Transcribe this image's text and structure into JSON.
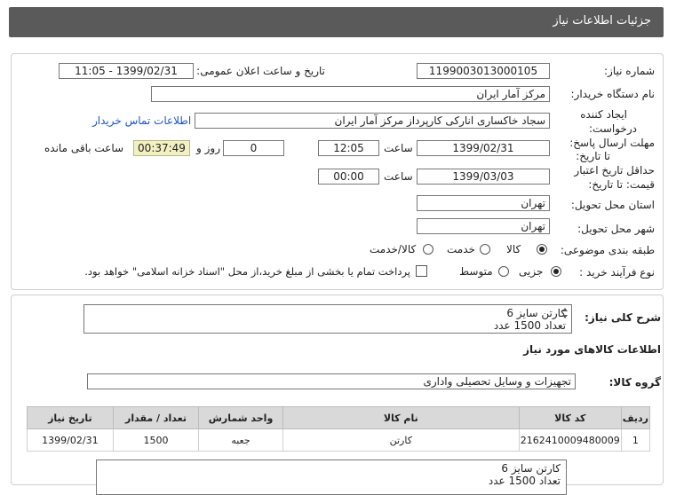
{
  "header": {
    "title": "جزئیات اطلاعات نیاز"
  },
  "form": {
    "need_number_label": "شماره نیاز:",
    "need_number": "1199003013000105",
    "announce_label": "تاریخ و ساعت اعلان عمومی:",
    "announce_value": "1399/02/31 - 11:05",
    "buyer_org_label": "نام دستگاه خریدار:",
    "buyer_org": "مرکز آمار ایران",
    "creator_label_1": "ایجاد کننده",
    "creator_label_2": "درخواست:",
    "creator": "سجاد خاکساری انارکی کارپرداز مرکز آمار ایران",
    "contact_link": "اطلاعات تماس خریدار",
    "reply_label_1": "مهلت ارسال پاسخ:",
    "reply_label_2": "تا تاریخ:",
    "reply_date": "1399/02/31",
    "time_label": "ساعت",
    "reply_time": "12:05",
    "days_value": "0",
    "days_label": "روز و",
    "countdown": "00:37:49",
    "remaining_label": "ساعت باقی مانده",
    "validity_label_1": "حداقل تاریخ اعتبار",
    "validity_label_2": "قیمت: تا تاریخ:",
    "validity_date": "1399/03/03",
    "validity_time": "00:00",
    "province_label": "استان محل تحویل:",
    "province": "تهران",
    "city_label": "شهر محل تحویل:",
    "city": "تهران",
    "category_label": "طبقه بندی موضوعی:",
    "category_options": [
      "کالا",
      "خدمت",
      "کالا/خدمت"
    ],
    "process_label": "نوع فرآیند خرید :",
    "process_options": [
      "جزیی",
      "متوسط"
    ],
    "process_note": "پرداخت تمام یا بخشی از مبلغ خرید،از محل \"اسناد خزانه اسلامی\" خواهد بود."
  },
  "details": {
    "summary_label": "شرح کلی نیاز:",
    "summary_lines": [
      "کارتن سایز 6",
      "تعداد 1500 عدد"
    ],
    "goods_info_title": "اطلاعات کالاهای مورد نیاز",
    "goods_group_label": "گروه کالا:",
    "goods_group": "تجهیزات و وسایل تحصیلی واداری",
    "table": {
      "headers": [
        "ردیف",
        "کد کالا",
        "نام کالا",
        "واحد شمارش",
        "تعداد / مقدار",
        "تاریخ نیاز"
      ],
      "rows": [
        [
          "1",
          "2162410009480009",
          "کارتن",
          "جعبه",
          "1500",
          "1399/02/31"
        ]
      ]
    },
    "note_lines": [
      "کارتن سایز 6",
      "تعداد 1500 عدد"
    ]
  }
}
